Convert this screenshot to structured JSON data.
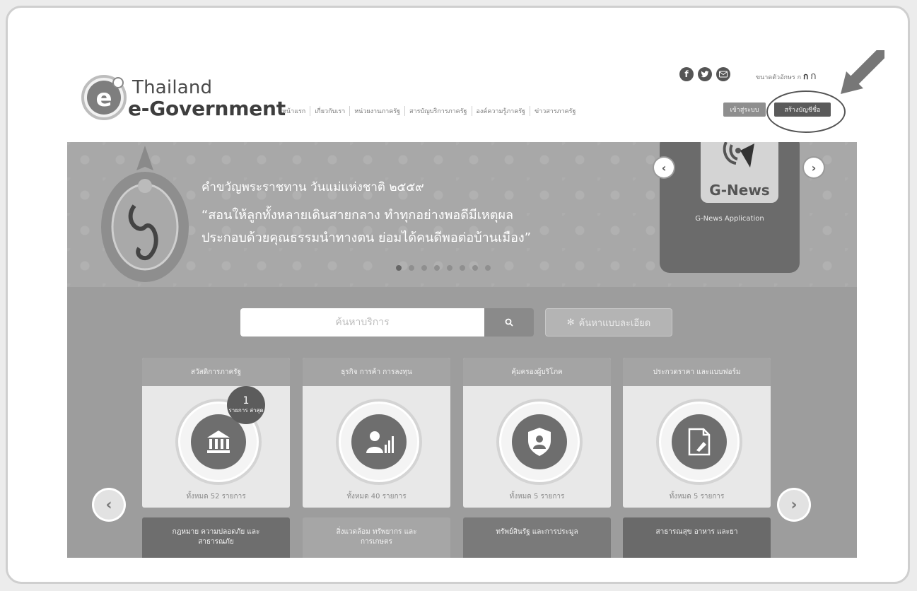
{
  "header": {
    "logo_line1": "Thailand",
    "logo_line2": "e-Government",
    "nav": [
      "หน้าแรก",
      "เกี่ยวกับเรา",
      "หน่วยงานภาครัฐ",
      "สารบัญบริการภาครัฐ",
      "องค์ความรู้ภาครัฐ",
      "ข่าวสารภาครัฐ"
    ],
    "login_label": "เข้าสู่ระบบ",
    "register_label": "สร้างบัญชีชื่อ",
    "font_size_label": "ขนาดตัวอักษร",
    "font_size_options": [
      "ก",
      "ก",
      "ก"
    ],
    "social_icons": [
      "facebook-icon",
      "twitter-icon",
      "email-icon"
    ]
  },
  "banner": {
    "line1": "คำขวัญพระราชทาน วันแม่แห่งชาติ ๒๕๕๙",
    "line2": "“สอนให้ลูกทั้งหลายเดินสายกลาง ทำทุกอย่างพอดีมีเหตุผล",
    "line3": "ประกอบด้วยคุณธรรมนำทางตน ย่อมได้คนดีพอต่อบ้านเมือง”",
    "gnews_title": "G-News",
    "gnews_subtitle": "G-News Application"
  },
  "search": {
    "placeholder": "ค้นหาบริการ",
    "advanced_label": "ค้นหาแบบละเอียด"
  },
  "cards": [
    {
      "title": "สวัสดิการภาครัฐ",
      "count": "ทั้งหมด 52 รายการ",
      "icon": "government-building-icon",
      "badge_n": "1",
      "badge_text": "รายการ ล่าสุด"
    },
    {
      "title": "ธุรกิจ การค้า การลงทุน",
      "count": "ทั้งหมด 40 รายการ",
      "icon": "business-growth-icon"
    },
    {
      "title": "คุ้มครองผู้บริโภค",
      "count": "ทั้งหมด 5 รายการ",
      "icon": "consumer-shield-icon"
    },
    {
      "title": "ประกวดราคา และแบบฟอร์ม",
      "count": "ทั้งหมด 5 รายการ",
      "icon": "document-form-icon"
    }
  ],
  "cards_row2": [
    {
      "title": "กฎหมาย ความปลอดภัย และ สาธารณภัย"
    },
    {
      "title": "สิ่งแวดล้อม ทรัพยากร และ การเกษตร"
    },
    {
      "title": "ทรัพย์สินรัฐ และการประมูล"
    },
    {
      "title": "สาธารณสุข อาหาร และยา"
    }
  ],
  "colors": {
    "banner_bg": "#a8a8a8",
    "content_bg": "#9d9d9d",
    "card_bg": "#e8e8e8"
  }
}
